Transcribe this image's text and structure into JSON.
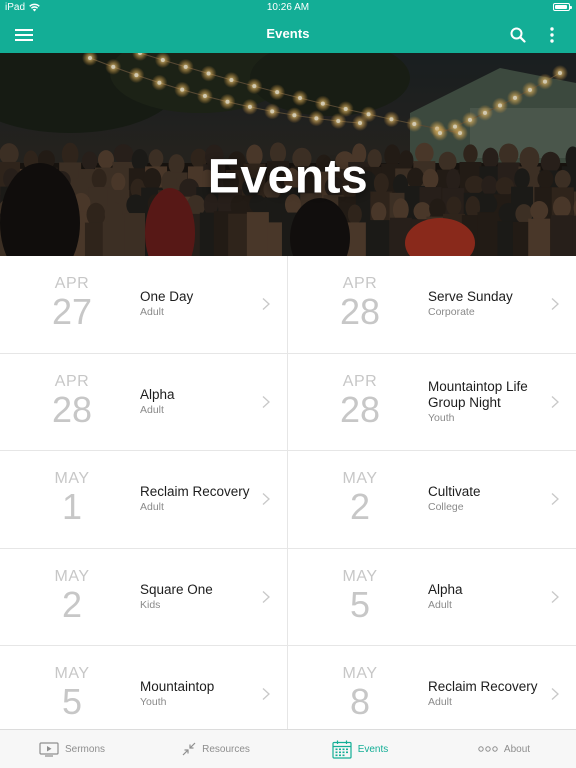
{
  "status_bar": {
    "device": "iPad",
    "time": "10:26 AM",
    "battery_level": 0.9
  },
  "nav": {
    "title": "Events",
    "menu_icon": "hamburger-icon",
    "search_icon": "search-icon",
    "more_icon": "more-vertical-icon"
  },
  "hero": {
    "title": "Events"
  },
  "events": [
    {
      "month": "APR",
      "day": "27",
      "title": "One Day",
      "category": "Adult"
    },
    {
      "month": "APR",
      "day": "28",
      "title": "Serve Sunday",
      "category": "Corporate"
    },
    {
      "month": "APR",
      "day": "28",
      "title": "Alpha",
      "category": "Adult"
    },
    {
      "month": "APR",
      "day": "28",
      "title": "Mountaintop Life Group Night",
      "category": "Youth"
    },
    {
      "month": "MAY",
      "day": "1",
      "title": "Reclaim Recovery",
      "category": "Adult"
    },
    {
      "month": "MAY",
      "day": "2",
      "title": "Cultivate",
      "category": "College"
    },
    {
      "month": "MAY",
      "day": "2",
      "title": "Square One",
      "category": "Kids"
    },
    {
      "month": "MAY",
      "day": "5",
      "title": "Alpha",
      "category": "Adult"
    },
    {
      "month": "MAY",
      "day": "5",
      "title": "Mountaintop",
      "category": "Youth"
    },
    {
      "month": "MAY",
      "day": "8",
      "title": "Reclaim Recovery",
      "category": "Adult"
    }
  ],
  "tabs": [
    {
      "label": "Sermons",
      "icon": "tv-play-icon",
      "active": false
    },
    {
      "label": "Resources",
      "icon": "arrows-in-icon",
      "active": false
    },
    {
      "label": "Events",
      "icon": "calendar-icon",
      "active": true
    },
    {
      "label": "About",
      "icon": "dots-icon",
      "active": false
    }
  ],
  "colors": {
    "accent": "#13ae96",
    "date_gray": "#c7c7c7",
    "tab_gray": "#8e8e8e"
  }
}
